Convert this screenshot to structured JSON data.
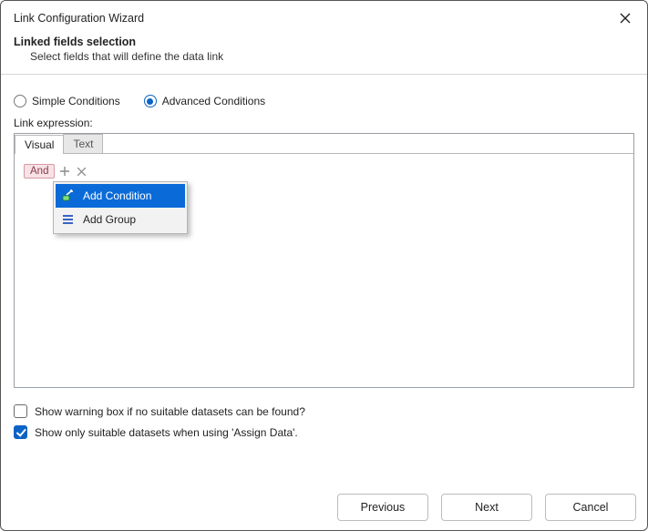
{
  "title": "Link Configuration Wizard",
  "heading": "Linked fields selection",
  "subheading": "Select fields that will define the data link",
  "radios": {
    "simple": "Simple Conditions",
    "advanced": "Advanced Conditions"
  },
  "link_expression_label": "Link expression:",
  "tabs": {
    "visual": "Visual",
    "text": "Text"
  },
  "and_tag": "And",
  "popup": {
    "add_condition": "Add Condition",
    "add_group": "Add Group"
  },
  "checks": {
    "warning": "Show warning box if no suitable datasets can be found?",
    "suitable": "Show only suitable datasets when using 'Assign Data'."
  },
  "buttons": {
    "previous": "Previous",
    "next": "Next",
    "cancel": "Cancel"
  }
}
